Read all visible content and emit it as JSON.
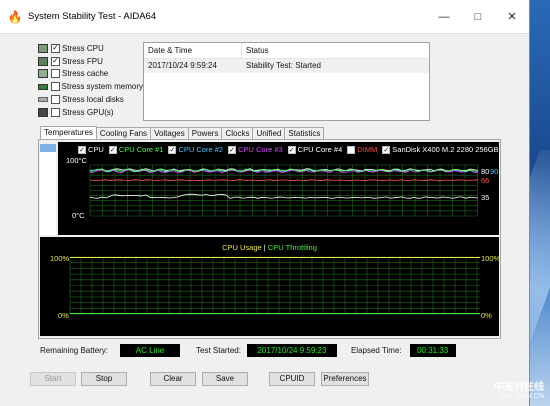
{
  "window": {
    "title": "System Stability Test - AIDA64",
    "icon": "flame-icon"
  },
  "stress_options": [
    {
      "label": "Stress CPU",
      "checked": true,
      "icon": "cpu-icon"
    },
    {
      "label": "Stress FPU",
      "checked": true,
      "icon": "fpu-icon"
    },
    {
      "label": "Stress cache",
      "checked": false,
      "icon": "cache-icon"
    },
    {
      "label": "Stress system memory",
      "checked": false,
      "icon": "memory-icon"
    },
    {
      "label": "Stress local disks",
      "checked": false,
      "icon": "disk-icon"
    },
    {
      "label": "Stress GPU(s)",
      "checked": false,
      "icon": "gpu-icon"
    }
  ],
  "log": {
    "columns": [
      "Date & Time",
      "Status"
    ],
    "rows": [
      {
        "datetime": "2017/10/24 9:59:24",
        "status": "Stability Test: Started"
      }
    ]
  },
  "tabs": [
    "Temperatures",
    "Cooling Fans",
    "Voltages",
    "Powers",
    "Clocks",
    "Unified",
    "Statistics"
  ],
  "active_tab": "Temperatures",
  "temperature_graph": {
    "legend": [
      {
        "label": "CPU",
        "color": "#ffffff",
        "checked": true
      },
      {
        "label": "CPU Core #1",
        "color": "#44ff44",
        "checked": true
      },
      {
        "label": "CPU Core #2",
        "color": "#44c8ff",
        "checked": true
      },
      {
        "label": "CPU Core #3",
        "color": "#dd44ff",
        "checked": true
      },
      {
        "label": "CPU Core #4",
        "color": "#ffffff",
        "checked": true
      },
      {
        "label": "DIMM",
        "color": "#ff4444",
        "checked": false
      },
      {
        "label": "SanDisk X400 M.2 2280 256GB",
        "color": "#ffffff",
        "checked": true
      }
    ],
    "y_max_label": "100°C",
    "y_min_label": "0°C",
    "values": [
      {
        "text": "80",
        "color": "#ffffff"
      },
      {
        "text": "90",
        "color": "#44c8ff"
      },
      {
        "text": "66",
        "color": "#ff5555"
      },
      {
        "text": "35",
        "color": "#ffffff"
      }
    ]
  },
  "usage_graph": {
    "title_usage": "CPU Usage",
    "separator": "|",
    "title_throttling": "CPU Throttling",
    "usage_color": "#e8e844",
    "throttling_color": "#44ee44",
    "left_max": "100%",
    "left_min": "0%",
    "right_max": "100%",
    "right_min": "0%"
  },
  "status": {
    "battery_label": "Remaining Battery:",
    "battery_value": "AC Line",
    "started_label": "Test Started:",
    "started_value": "2017/10/24 9:59:23",
    "elapsed_label": "Elapsed Time:",
    "elapsed_value": "00:31:33"
  },
  "buttons": {
    "start": "Start",
    "stop": "Stop",
    "clear": "Clear",
    "save": "Save",
    "cpuid": "CPUID",
    "preferences": "Preferences"
  },
  "watermark": {
    "main": "中关村在线",
    "sub": "ZOL.COM.CN"
  }
}
